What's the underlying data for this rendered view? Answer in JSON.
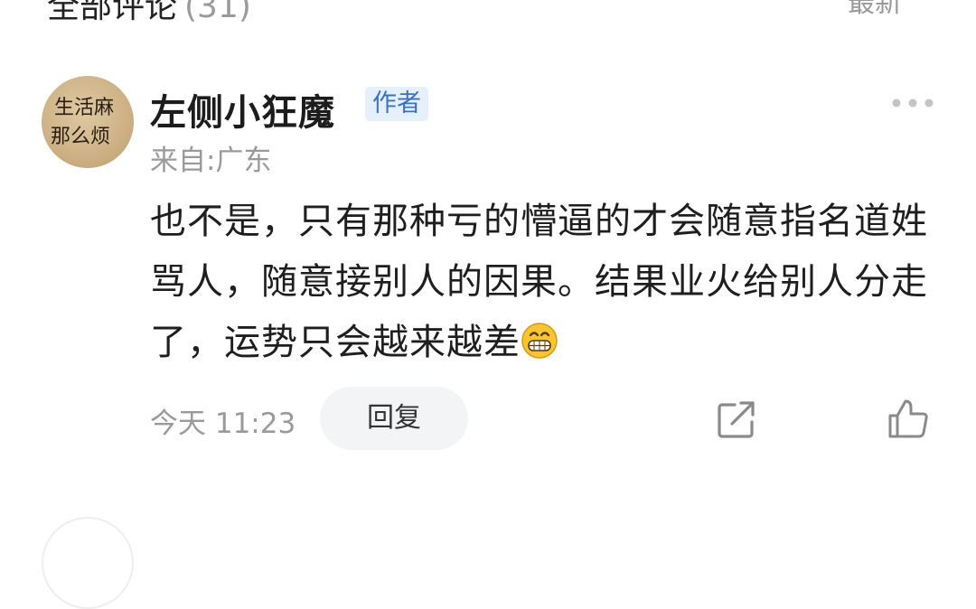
{
  "header": {
    "title": "全部评论",
    "count": "(31)",
    "right_action": "最新"
  },
  "comment": {
    "avatar_text_line1": "生活麻",
    "avatar_text_line2": "那么烦",
    "author": "左侧小狂魔",
    "author_badge": "作者",
    "location": "来自:广东",
    "body": "也不是，只有那种亏的懵逼的才会随意指名道姓骂人，随意接别人的因果。结果业火给别人分走了，运势只会越来越差",
    "body_emoji": "grinning-face-emoji",
    "timestamp": "今天 11:23",
    "reply_label": "回复",
    "icons": {
      "more": "more-dots-icon",
      "share": "share-icon",
      "like": "thumbs-up-icon"
    }
  },
  "colors": {
    "accent": "#3a72c2",
    "badge_bg": "#e6f0fb",
    "muted_text": "#9a9a9a",
    "button_bg": "#f3f4f6"
  }
}
